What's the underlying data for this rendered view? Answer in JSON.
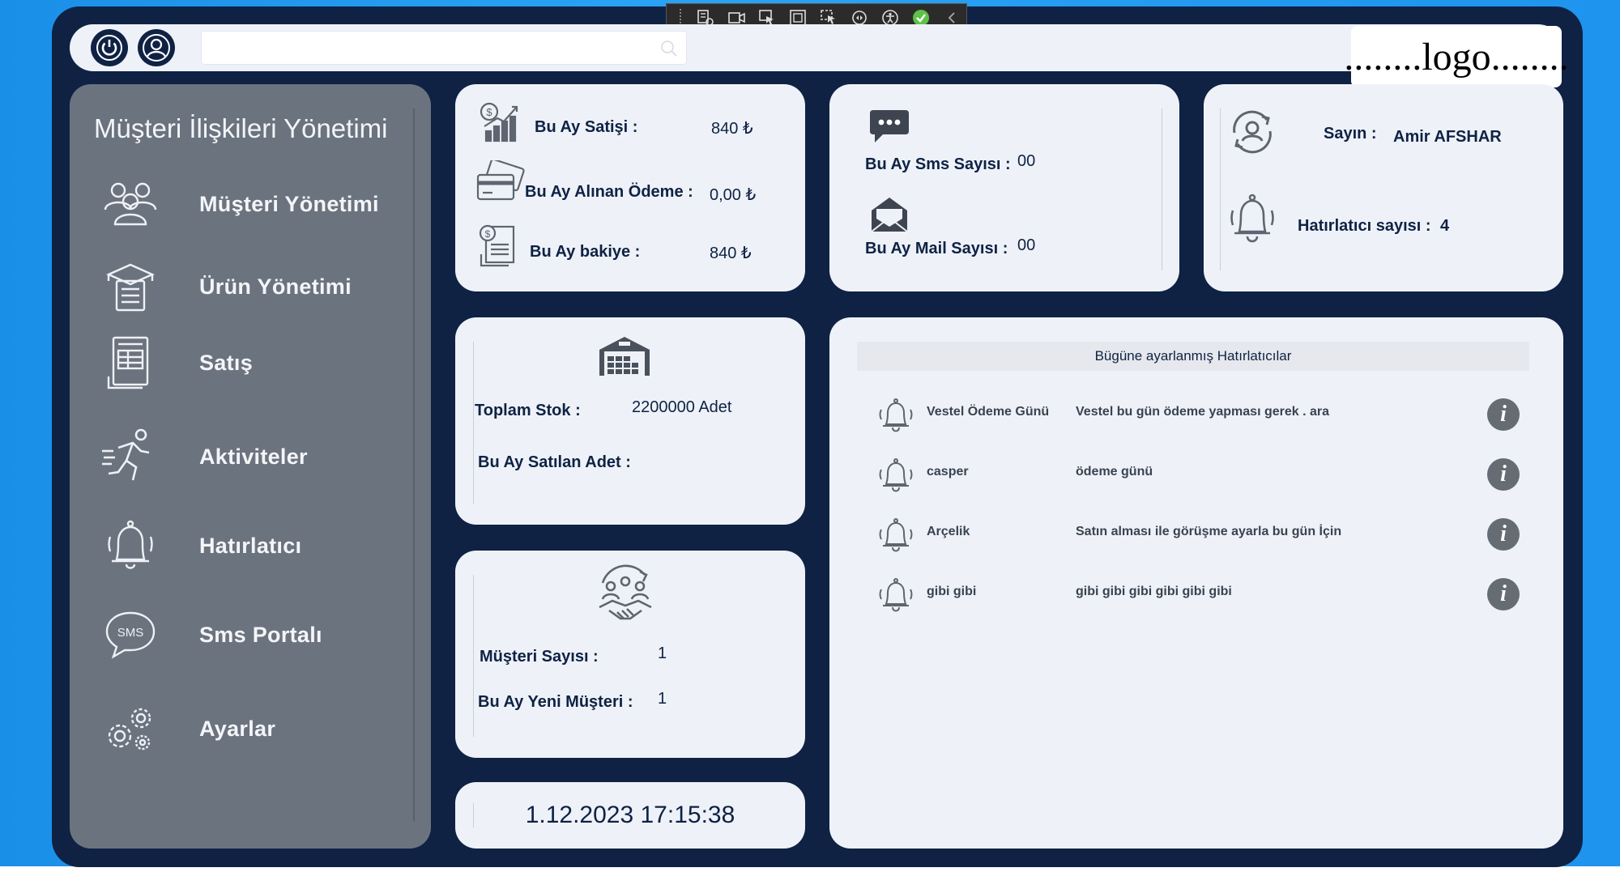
{
  "colors": {
    "frame": "#0f2244",
    "sidebar": "#6b737f",
    "card": "#eef2f8",
    "accent": "#1a8fe8"
  },
  "topbar": {
    "search_placeholder": "",
    "power_icon": "power-icon",
    "user_icon": "user-circle-icon"
  },
  "logo": {
    "text": "........logo........"
  },
  "sidebar": {
    "title": "Müşteri İlişkileri Yönetimi",
    "items": [
      {
        "label": "Müşteri Yönetimi",
        "icon": "customers-icon"
      },
      {
        "label": "Ürün Yönetimi",
        "icon": "product-box-icon"
      },
      {
        "label": "Satış",
        "icon": "invoice-icon"
      },
      {
        "label": "Aktiviteler",
        "icon": "running-person-icon"
      },
      {
        "label": "Hatırlatıcı",
        "icon": "bell-icon"
      },
      {
        "label": "Sms Portalı",
        "icon": "sms-icon"
      },
      {
        "label": "Ayarlar",
        "icon": "gears-icon"
      }
    ]
  },
  "sales": {
    "sale_label": "Bu Ay Satişi :",
    "sale_value": "840 ₺",
    "payment_label": "Bu Ay Alınan Ödeme :",
    "payment_value": "0,00 ₺",
    "balance_label": "Bu Ay bakiye :",
    "balance_value": "840 ₺"
  },
  "messages": {
    "sms_label": "Bu Ay Sms Sayısı :",
    "sms_value": "00",
    "mail_label": "Bu Ay Mail Sayısı :",
    "mail_value": "00"
  },
  "user": {
    "greet_label": "Sayın :",
    "name": "Amir AFSHAR",
    "reminder_label": "Hatırlatıcı sayısı :",
    "reminder_count": "4"
  },
  "stock": {
    "total_label": "Toplam Stok :",
    "total_value": "2200000 Adet",
    "sold_label": "Bu Ay Satılan Adet :",
    "sold_value": ""
  },
  "customers": {
    "count_label": "Müşteri Sayısı :",
    "count_value": "1",
    "new_label": "Bu Ay Yeni Müşteri :",
    "new_value": "1"
  },
  "datetime": "1.12.2023 17:15:38",
  "reminders": {
    "header": "Bügüne ayarlanmış Hatırlatıcılar",
    "rows": [
      {
        "title": "Vestel Ödeme Günü",
        "desc": "Vestel bu gün ödeme yapması gerek . ara"
      },
      {
        "title": "casper",
        "desc": "ödeme günü"
      },
      {
        "title": "Arçelik",
        "desc": "Satın alması ile görüşme ayarla bu gün İçin"
      },
      {
        "title": "gibi gibi",
        "desc": "gibi gibi gibi gibi gibi gibi"
      }
    ]
  }
}
